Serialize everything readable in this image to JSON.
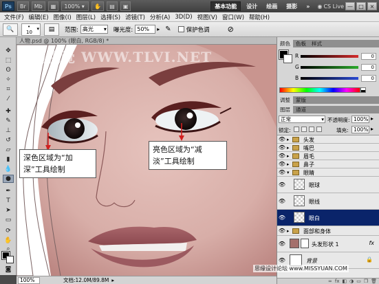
{
  "appbar": {
    "logo": "Ps",
    "zoom": "100%",
    "workspaces": [
      "基本功能",
      "设计",
      "绘画",
      "摄影"
    ],
    "more": "»",
    "cslive": "CS Live",
    "window_controls": [
      "—",
      "□",
      "×"
    ]
  },
  "menubar": {
    "items": [
      "文件(F)",
      "编辑(E)",
      "图像(I)",
      "图层(L)",
      "选择(S)",
      "滤镜(T)",
      "分析(A)",
      "3D(D)",
      "视图(V)",
      "窗口(W)",
      "帮助(H)"
    ]
  },
  "options": {
    "brush_size": "10",
    "range_label": "范围:",
    "range_value": "高光",
    "exposure_label": "曝光度:",
    "exposure_value": "50%",
    "protect_tones_label": "保护色调"
  },
  "document": {
    "tab_title": "人物.psd @ 100% (眼白, RGB/8) *",
    "watermark": "騰龍視覺 WWW.TLVI.NET",
    "callout_left": [
      "深色区域为“加",
      "深”工具绘制"
    ],
    "callout_right": [
      "亮色区域为“减",
      "淡”工具绘制"
    ]
  },
  "status": {
    "zoom": "100%",
    "doc_info": "文档:12.0M/89.8M"
  },
  "color_panel": {
    "tabs": [
      "颜色",
      "色板",
      "样式"
    ],
    "channels": [
      {
        "label": "R",
        "value": "0",
        "color": "#d42b2b"
      },
      {
        "label": "G",
        "value": "0",
        "color": "#2baa2b"
      },
      {
        "label": "B",
        "value": "0",
        "color": "#2b4bd4"
      }
    ]
  },
  "adjust_panel": {
    "tabs": [
      "调整",
      "蒙版"
    ]
  },
  "layers_panel": {
    "tabs": [
      "图层",
      "通道"
    ],
    "blend_mode": "正常",
    "opacity_label": "不透明度:",
    "opacity_value": "100%",
    "lock_label": "锁定:",
    "fill_label": "填充:",
    "fill_value": "100%",
    "layers": [
      {
        "name": "头发",
        "type": "group"
      },
      {
        "name": "嘴巴",
        "type": "group"
      },
      {
        "name": "眉毛",
        "type": "group"
      },
      {
        "name": "鼻子",
        "type": "group"
      },
      {
        "name": "眼睛",
        "type": "group-open"
      },
      {
        "name": "眼球",
        "type": "layer"
      },
      {
        "name": "眼线",
        "type": "layer"
      },
      {
        "name": "眼白",
        "type": "layer",
        "selected": true
      },
      {
        "name": "面部和身体",
        "type": "group"
      },
      {
        "name": "头发形状 1",
        "type": "shape"
      },
      {
        "name": "背景",
        "type": "background"
      }
    ],
    "footer_icons": [
      "link-icon",
      "fx-icon",
      "mask-icon",
      "adjust-icon",
      "folder-icon",
      "new-layer-icon",
      "trash-icon"
    ],
    "footer_fx": "fx"
  },
  "site_watermark": "思缘设计论坛 www.MISSYUAN.COM",
  "colors": {
    "accent": "#0a246a",
    "skin": "#d9b1ad",
    "arrow": "#d21f1f"
  }
}
